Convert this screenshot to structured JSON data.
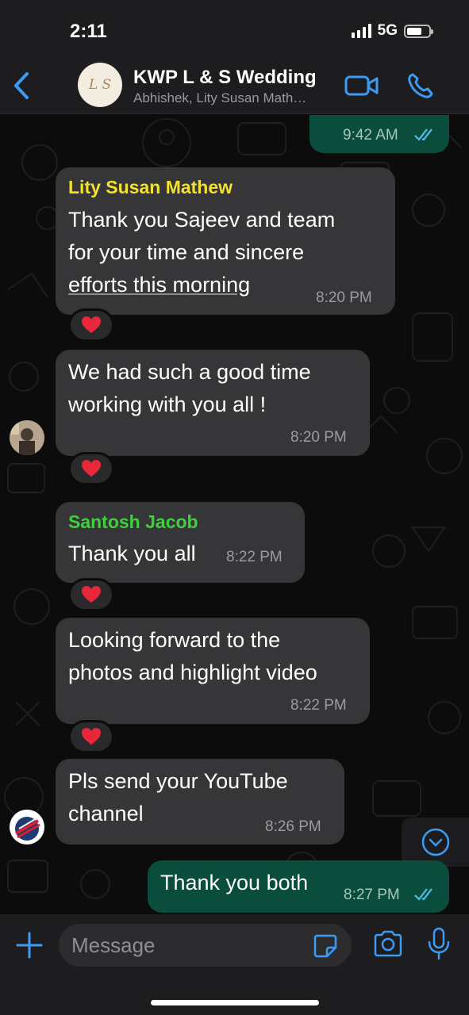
{
  "status_bar": {
    "time": "2:11",
    "network": "5G"
  },
  "header": {
    "title": "KWP L & S Wedding",
    "subtitle": "Abhishek, Lity Susan Math…",
    "group_avatar_text": "L S"
  },
  "colors": {
    "accent": "#3b9bf5",
    "outgoing_bubble": "#0b4d3c",
    "incoming_bubble": "#363638",
    "sender_lity": "#f5e12d",
    "sender_santosh": "#3fcf3f",
    "reaction_heart": "#e8283a"
  },
  "messages": [
    {
      "direction": "out",
      "text": "",
      "time": "9:42 AM",
      "status": "read"
    },
    {
      "direction": "in",
      "sender": "Lity Susan Mathew",
      "text_lines": [
        "Thank you Sajeev and team",
        "for your time and sincere",
        "efforts this morning"
      ],
      "time": "8:20 PM",
      "reaction": "heart"
    },
    {
      "direction": "in",
      "text_lines": [
        "We had such a good time",
        "working with you all !"
      ],
      "time": "8:20 PM",
      "reaction": "heart"
    },
    {
      "direction": "in",
      "sender": "Santosh Jacob",
      "text_lines": [
        "Thank you all"
      ],
      "time": "8:22 PM",
      "reaction": "heart"
    },
    {
      "direction": "in",
      "text_lines": [
        "Looking forward to the",
        "photos and highlight video"
      ],
      "time": "8:22 PM",
      "reaction": "heart"
    },
    {
      "direction": "in",
      "text_lines": [
        "Pls send your YouTube",
        "channel"
      ],
      "time": "8:26 PM"
    },
    {
      "direction": "out",
      "text_lines": [
        "Thank you both"
      ],
      "time": "8:27 PM",
      "status": "read"
    }
  ],
  "input": {
    "placeholder": "Message"
  },
  "icons": {
    "back": "chevron-left-icon",
    "video": "video-camera-icon",
    "call": "phone-icon",
    "plus": "plus-icon",
    "sticker": "sticker-icon",
    "camera": "camera-icon",
    "mic": "microphone-icon",
    "scroll": "chevron-down-circle-icon"
  }
}
